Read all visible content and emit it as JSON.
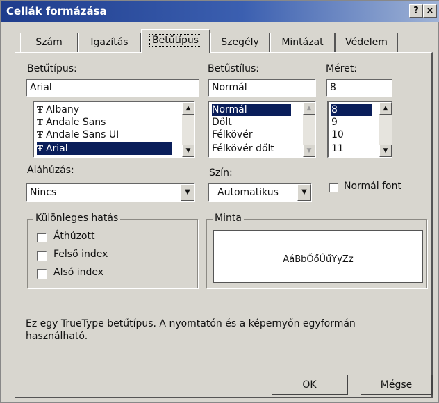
{
  "title": "Cellák formázása",
  "titlebar": {
    "help": "?",
    "close": "×"
  },
  "tabs": [
    "Szám",
    "Igazítás",
    "Betűtípus",
    "Szegély",
    "Mintázat",
    "Védelem"
  ],
  "active_tab": "Betűtípus",
  "font": {
    "label": "Betűtípus:",
    "value": "Arial",
    "items": [
      "Albany",
      "Andale Sans",
      "Andale Sans UI",
      "Arial"
    ],
    "selected": "Arial",
    "tt_glyph": "Ŧ"
  },
  "style": {
    "label": "Betűstílus:",
    "value": "Normál",
    "items": [
      "Normál",
      "Dőlt",
      "Félkövér",
      "Félkövér dőlt"
    ],
    "selected": "Normál"
  },
  "size": {
    "label": "Méret:",
    "value": "8",
    "items": [
      "8",
      "9",
      "10",
      "11"
    ],
    "selected": "8"
  },
  "underline": {
    "label": "Aláhúzás:",
    "value": "Nincs"
  },
  "color": {
    "label": "Szín:",
    "value": "Automatikus"
  },
  "normal_font": {
    "label": "Normál font",
    "checked": false
  },
  "effects": {
    "label": "Különleges hatás",
    "strike": "Áthúzott",
    "superscript": "Felső index",
    "subscript": "Alsó index"
  },
  "preview": {
    "label": "Minta",
    "sample": "AáBbŐőŰűYyZz"
  },
  "info": "Ez egy TrueType betűtípus.  A nyomtatón és a képernyőn egyformán használható.",
  "buttons": {
    "ok": "OK",
    "cancel": "Mégse"
  },
  "arrows": {
    "up": "▲",
    "down": "▼"
  }
}
